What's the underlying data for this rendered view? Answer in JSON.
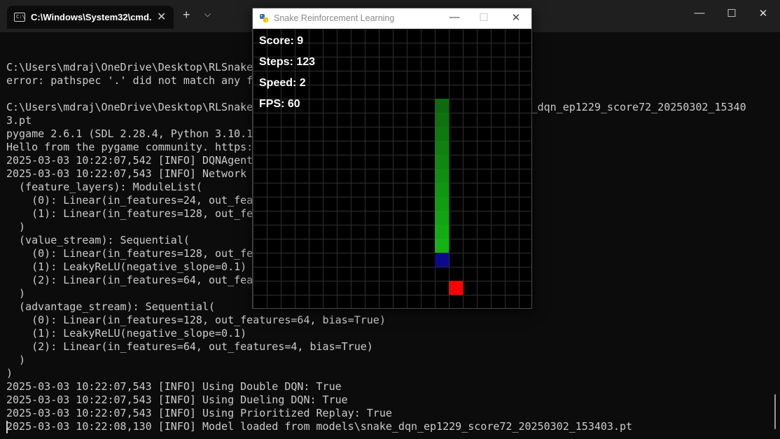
{
  "terminal": {
    "tab_title": "C:\\Windows\\System32\\cmd.e",
    "tab_icon_text": "C:\\",
    "new_tab_glyph": "+",
    "tab_menu_glyph": "⌵",
    "close_tab_glyph": "✕",
    "minimize_glyph": "—",
    "maximize_glyph": "☐",
    "close_glyph": "✕",
    "lines": [
      "",
      "C:\\Users\\mdraj\\OneDrive\\Desktop\\RLSnake",
      "error: pathspec '.' did not match any f",
      "",
      "C:\\Users\\mdraj\\OneDrive\\Desktop\\RLSnake                                         ake_dqn_ep1229_score72_20250302_15340",
      "3.pt",
      "pygame 2.6.1 (SDL 2.28.4, Python 3.10.1",
      "Hello from the pygame community. https:",
      "2025-03-03 10:22:07,542 [INFO] DQNAgent",
      "2025-03-03 10:22:07,543 [INFO] Network",
      "  (feature_layers): ModuleList(",
      "    (0): Linear(in_features=24, out_fea",
      "    (1): Linear(in_features=128, out_fe",
      "  )",
      "  (value_stream): Sequential(",
      "    (0): Linear(in_features=128, out_fe",
      "    (1): LeakyReLU(negative_slope=0.1)",
      "    (2): Linear(in_features=64, out_fea",
      "  )",
      "  (advantage_stream): Sequential(",
      "    (0): Linear(in_features=128, out_features=64, bias=True)",
      "    (1): LeakyReLU(negative_slope=0.1)",
      "    (2): Linear(in_features=64, out_features=4, bias=True)",
      "  )",
      ")",
      "2025-03-03 10:22:07,543 [INFO] Using Double DQN: True",
      "2025-03-03 10:22:07,543 [INFO] Using Dueling DQN: True",
      "2025-03-03 10:22:07,543 [INFO] Using Prioritized Replay: True",
      "2025-03-03 10:22:08,130 [INFO] Model loaded from models\\snake_dqn_ep1229_score72_20250302_153403.pt"
    ]
  },
  "pygame_window": {
    "title": "Snake Reinforcement Learning",
    "minimize_glyph": "—",
    "maximize_glyph": "☐",
    "close_glyph": "✕",
    "hud": {
      "score": "Score: 9",
      "steps": "Steps: 123",
      "speed": "Speed: 2",
      "fps": "FPS: 60"
    },
    "game": {
      "grid_cols": 20,
      "grid_rows": 20,
      "snake_body": [
        [
          13,
          5
        ],
        [
          13,
          6
        ],
        [
          13,
          7
        ],
        [
          13,
          8
        ],
        [
          13,
          9
        ],
        [
          13,
          10
        ],
        [
          13,
          11
        ],
        [
          13,
          12
        ],
        [
          13,
          13
        ],
        [
          13,
          14
        ],
        [
          13,
          15
        ]
      ],
      "snake_head": [
        13,
        16
      ],
      "food": [
        14,
        18
      ],
      "colors": {
        "background": "#000000",
        "grid": "#2f2f2f",
        "body_tail": "#0e6a0e",
        "body_front": "#14b214",
        "head": "#0a0a8a",
        "food": "#ff0000"
      }
    }
  }
}
